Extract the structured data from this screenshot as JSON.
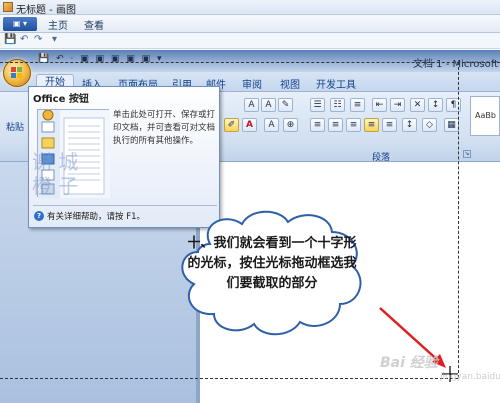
{
  "paint": {
    "window_title": "无标题 - 画图",
    "menu_file": "▣ ▾",
    "tabs": [
      "主页",
      "查看"
    ],
    "quick_access": [
      "💾",
      "↶",
      "↷",
      "▾"
    ]
  },
  "word": {
    "doc_title": "文档 1 - Microsoft",
    "qat_icons": "💾 ↶ · ▣ ▣ ▣ ▣ ▣ ▾",
    "tabs": [
      "开始",
      "插入",
      "页面布局",
      "引用",
      "邮件",
      "审阅",
      "视图",
      "开发工具"
    ],
    "paragraph_group": "段落",
    "style_sample": "AaBb",
    "launcher_glyph": "↘"
  },
  "office_tooltip": {
    "title": "Office 按钮",
    "description": "单击此处可打开、保存或打印文档，并可查看可对文档执行的所有其他操作。",
    "help_text": "有关详细帮助，请按 F1。",
    "help_icon": "?"
  },
  "left_label": "粘贴",
  "watermark": "谢 城 橙 子",
  "callout": {
    "text": "十、我们就会看到一个十字形的光标，按住光标拖动框选我们要截取的部分"
  },
  "baidu_watermark": "Bai 经验",
  "baidu_url": "jingyan.baidu.com",
  "colors": {
    "ribbon": "#d2e0f1",
    "arrow": "#e02020",
    "cloud_fill": "#ffffff",
    "cloud_stroke": "#2f5fa8"
  }
}
